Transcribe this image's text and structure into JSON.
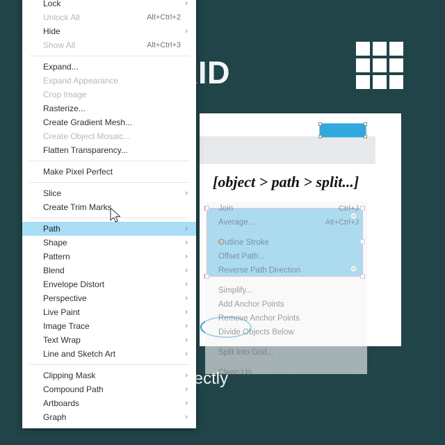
{
  "poster": {
    "title": "O GRID",
    "body": "ting layouts with perfectly\ners.",
    "bg_color": "#1e4246",
    "title_color": "#f2f6f6",
    "grid_icon": "grid-3x3-icon"
  },
  "artboard": {
    "caption": "[object > path > split...]",
    "blue_bar_color": "#32a8dd",
    "toolbar_color": "#e7e9ea"
  },
  "canvas_object": {
    "fill_color": "#36b0e6",
    "selection_border_color": "#b06fb4",
    "highlight_oval_color": "#2f9fd4"
  },
  "menu": {
    "name": "object-menu",
    "items": [
      {
        "label": "Lock",
        "shortcut": "",
        "arrow": true,
        "state": "normal"
      },
      {
        "label": "Unlock All",
        "shortcut": "Alt+Ctrl+2",
        "arrow": false,
        "state": "dim"
      },
      {
        "label": "Hide",
        "shortcut": "",
        "arrow": true,
        "state": "normal"
      },
      {
        "label": "Show All",
        "shortcut": "Alt+Ctrl+3",
        "arrow": false,
        "state": "dim"
      },
      {
        "separator": true
      },
      {
        "label": "Expand...",
        "shortcut": "",
        "arrow": false,
        "state": "normal"
      },
      {
        "label": "Expand Appearance",
        "shortcut": "",
        "arrow": false,
        "state": "dim"
      },
      {
        "label": "Crop Image",
        "shortcut": "",
        "arrow": false,
        "state": "dim"
      },
      {
        "label": "Rasterize...",
        "shortcut": "",
        "arrow": false,
        "state": "normal"
      },
      {
        "label": "Create Gradient Mesh...",
        "shortcut": "",
        "arrow": false,
        "state": "normal"
      },
      {
        "label": "Create Object Mosaic...",
        "shortcut": "",
        "arrow": false,
        "state": "dim"
      },
      {
        "label": "Flatten Transparency...",
        "shortcut": "",
        "arrow": false,
        "state": "normal"
      },
      {
        "separator": true
      },
      {
        "label": "Make Pixel Perfect",
        "shortcut": "",
        "arrow": false,
        "state": "normal"
      },
      {
        "separator": true
      },
      {
        "label": "Slice",
        "shortcut": "",
        "arrow": true,
        "state": "normal"
      },
      {
        "label": "Create Trim Marks",
        "shortcut": "",
        "arrow": false,
        "state": "normal"
      },
      {
        "separator": true
      },
      {
        "label": "Path",
        "shortcut": "",
        "arrow": true,
        "state": "selected"
      },
      {
        "label": "Shape",
        "shortcut": "",
        "arrow": true,
        "state": "normal"
      },
      {
        "label": "Pattern",
        "shortcut": "",
        "arrow": true,
        "state": "normal"
      },
      {
        "label": "Blend",
        "shortcut": "",
        "arrow": true,
        "state": "normal"
      },
      {
        "label": "Envelope Distort",
        "shortcut": "",
        "arrow": true,
        "state": "normal"
      },
      {
        "label": "Perspective",
        "shortcut": "",
        "arrow": true,
        "state": "normal"
      },
      {
        "label": "Live Paint",
        "shortcut": "",
        "arrow": true,
        "state": "normal"
      },
      {
        "label": "Image Trace",
        "shortcut": "",
        "arrow": true,
        "state": "normal"
      },
      {
        "label": "Text Wrap",
        "shortcut": "",
        "arrow": true,
        "state": "normal"
      },
      {
        "label": "Line and Sketch Art",
        "shortcut": "",
        "arrow": true,
        "state": "normal"
      },
      {
        "separator": true
      },
      {
        "label": "Clipping Mask",
        "shortcut": "",
        "arrow": true,
        "state": "normal"
      },
      {
        "label": "Compound Path",
        "shortcut": "",
        "arrow": true,
        "state": "normal"
      },
      {
        "label": "Artboards",
        "shortcut": "",
        "arrow": true,
        "state": "normal"
      },
      {
        "label": "Graph",
        "shortcut": "",
        "arrow": true,
        "state": "normal"
      }
    ]
  },
  "submenu": {
    "name": "path-submenu",
    "items": [
      {
        "label": "Join",
        "shortcut": "Ctrl+J"
      },
      {
        "label": "Average...",
        "shortcut": "Alt+Ctrl+J"
      },
      {
        "separator": true
      },
      {
        "label": "Outline Stroke",
        "shortcut": ""
      },
      {
        "label": "Offset Path...",
        "shortcut": ""
      },
      {
        "label": "Reverse Path Direction",
        "shortcut": ""
      },
      {
        "separator": true
      },
      {
        "label": "Simplify...",
        "shortcut": ""
      },
      {
        "label": "Add Anchor Points",
        "shortcut": ""
      },
      {
        "label": "Remove Anchor Points",
        "shortcut": ""
      },
      {
        "label": "Divide Objects Below",
        "shortcut": ""
      },
      {
        "separator": true
      },
      {
        "label": "Split Into Grid...",
        "shortcut": ""
      },
      {
        "separator": true
      },
      {
        "label": "Clean Up...",
        "shortcut": ""
      }
    ]
  },
  "cursor": {
    "icon": "mouse-pointer-icon"
  }
}
